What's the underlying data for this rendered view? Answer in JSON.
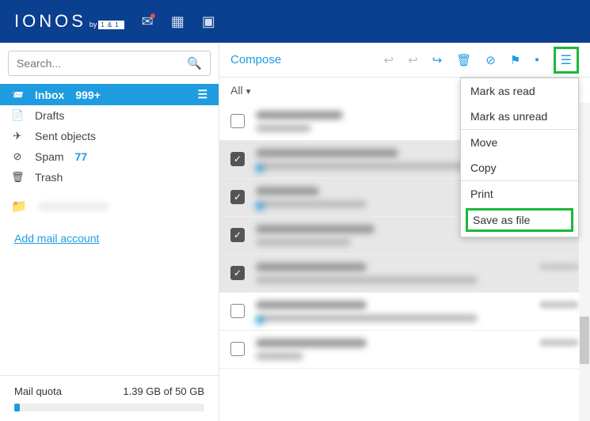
{
  "brand": {
    "name": "IONOS",
    "by": "by",
    "sub": "1&1"
  },
  "search": {
    "placeholder": "Search..."
  },
  "folders": {
    "inbox": {
      "label": "Inbox",
      "count": "999+"
    },
    "drafts": {
      "label": "Drafts"
    },
    "sent": {
      "label": "Sent objects"
    },
    "spam": {
      "label": "Spam",
      "count": "77"
    },
    "trash": {
      "label": "Trash"
    }
  },
  "addAccount": "Add mail account",
  "quota": {
    "label": "Mail quota",
    "text": "1.39 GB of 50 GB"
  },
  "toolbar": {
    "compose": "Compose"
  },
  "filter": {
    "all": "All"
  },
  "menu": {
    "read": "Mark as read",
    "unread": "Mark as unread",
    "move": "Move",
    "copy": "Copy",
    "print": "Print",
    "save": "Save as file"
  }
}
